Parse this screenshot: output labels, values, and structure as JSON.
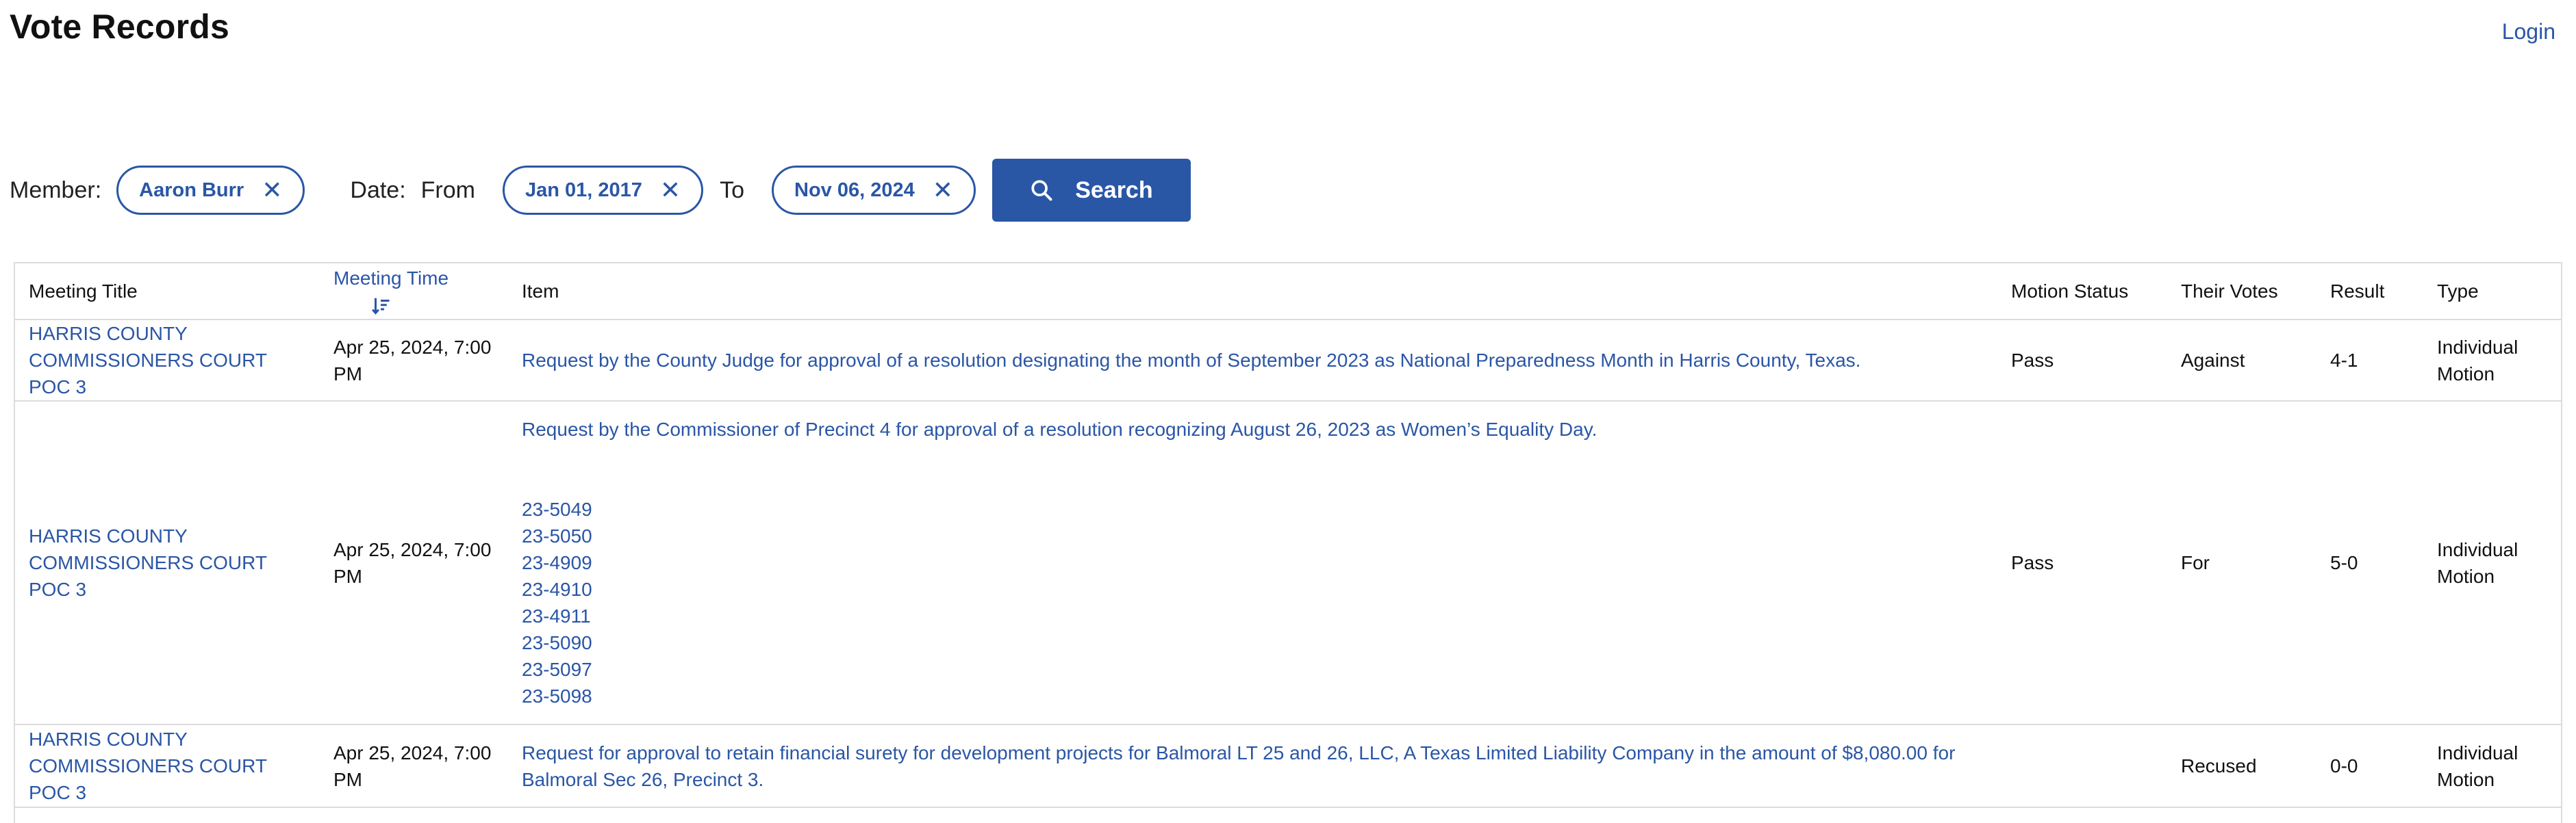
{
  "header": {
    "title": "Vote Records",
    "login_label": "Login"
  },
  "filters": {
    "member_label": "Member:",
    "member_value": "Aaron Burr",
    "date_label": "Date:",
    "from_label": "From",
    "from_value": "Jan 01, 2017",
    "to_label": "To",
    "to_value": "Nov 06, 2024",
    "search_label": "Search"
  },
  "table": {
    "columns": {
      "meeting_title": "Meeting Title",
      "meeting_time": "Meeting Time",
      "item": "Item",
      "motion_status": "Motion Status",
      "their_votes": "Their Votes",
      "result": "Result",
      "type": "Type"
    },
    "rows": [
      {
        "meeting_title_1": "HARRIS COUNTY",
        "meeting_title_2": "COMMISSIONERS COURT POC 3",
        "time_1": "Apr 25, 2024, 7:00",
        "time_2": "PM",
        "item": "Request by the County Judge for approval of a resolution designating the month of September 2023 as National Preparedness Month in Harris County, Texas.",
        "motion_status": "Pass",
        "their_vote": "Against",
        "result": "4-1",
        "type_1": "Individual",
        "type_2": "Motion"
      },
      {
        "meeting_title_1": "HARRIS COUNTY",
        "meeting_title_2": "COMMISSIONERS COURT POC 3",
        "time_1": "Apr 25, 2024, 7:00",
        "time_2": "PM",
        "item": "Request by the Commissioner of Precinct 4 for approval of a resolution recognizing August 26, 2023 as Women’s Equality Day.",
        "codes": [
          "23-5049",
          "23-5050",
          "23-4909",
          "23-4910",
          "23-4911",
          "23-5090",
          "23-5097",
          "23-5098"
        ],
        "motion_status": "Pass",
        "their_vote": "For",
        "result": "5-0",
        "type_1": "Individual",
        "type_2": "Motion"
      },
      {
        "meeting_title_1": "HARRIS COUNTY",
        "meeting_title_2": "COMMISSIONERS COURT POC 3",
        "time_1": "Apr 25, 2024, 7:00",
        "time_2": "PM",
        "item_1": "Request for approval to retain financial surety for development projects for Balmoral LT 25 and 26, LLC, A Texas Limited Liability Company in the amount of $8,080.00 for",
        "item_2": "Balmoral Sec 26, Precinct 3.",
        "motion_status": "",
        "their_vote": "Recused",
        "result": "0-0",
        "type_1": "Individual",
        "type_2": "Motion"
      }
    ]
  },
  "colors": {
    "accent": "#2a56a6",
    "border": "#dcdcdc",
    "text": "#111111"
  },
  "icons": {
    "search": "search-icon",
    "close": "close-icon",
    "sort": "sort-descending-icon"
  }
}
